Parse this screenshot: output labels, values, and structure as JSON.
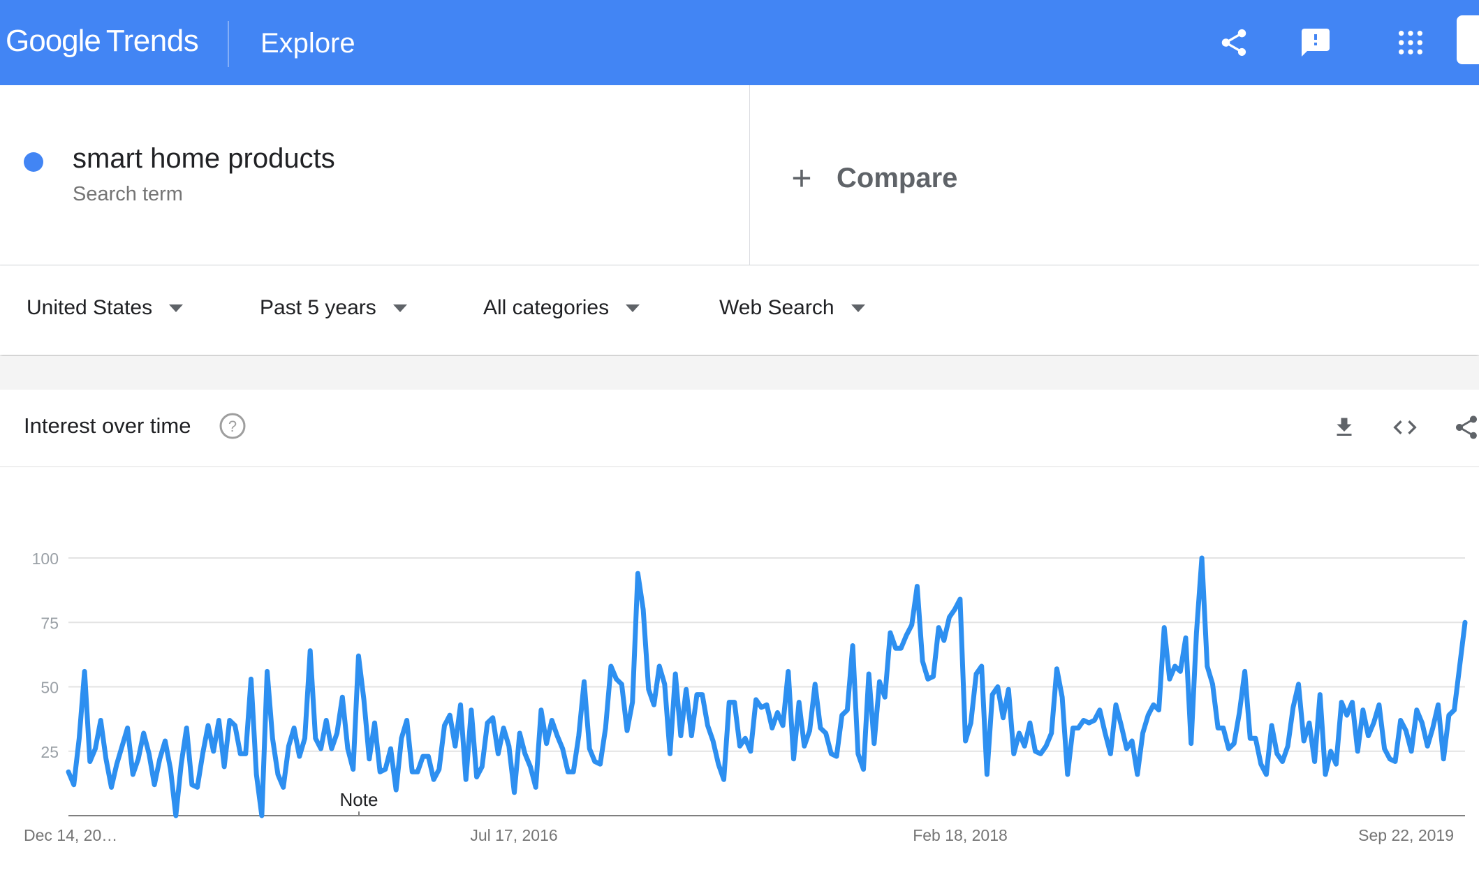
{
  "header": {
    "brand_google": "Google",
    "brand_trends": "Trends",
    "page": "Explore",
    "bg_color": "#4285f4",
    "icons": [
      "share-icon",
      "feedback-icon",
      "apps-grid-icon"
    ]
  },
  "search": {
    "term": "smart home products",
    "term_type": "Search term",
    "term_color": "#4285f4",
    "compare_symbol": "+",
    "compare_label": "Compare"
  },
  "filters": {
    "geo": "United States",
    "time": "Past 5 years",
    "category": "All categories",
    "property": "Web Search"
  },
  "card": {
    "title": "Interest over time",
    "help_symbol": "?",
    "icons": [
      "download-icon",
      "embed-code-icon",
      "share-icon"
    ]
  },
  "chart_data": {
    "type": "line",
    "title": "",
    "xlabel": "",
    "ylabel": "",
    "ylim": [
      0,
      100
    ],
    "y_ticks": [
      "25",
      "50",
      "75",
      "100"
    ],
    "grid": true,
    "line_color": "#2d8ff0",
    "x_tick_labels": [
      "Dec 14, 20…",
      "Jul 17, 2016",
      "Feb 18, 2018",
      "Sep 22, 2019"
    ],
    "annotation": "Note",
    "series": [
      {
        "name": "",
        "values": [
          17,
          12,
          30,
          56,
          21,
          26,
          37,
          22,
          11,
          20,
          27,
          34,
          16,
          22,
          32,
          24,
          12,
          22,
          29,
          18,
          0,
          20,
          34,
          12,
          11,
          24,
          35,
          25,
          37,
          19,
          37,
          35,
          24,
          24,
          53,
          16,
          0,
          56,
          30,
          16,
          11,
          27,
          34,
          23,
          30,
          64,
          30,
          26,
          37,
          26,
          32,
          46,
          26,
          18,
          62,
          45,
          22,
          36,
          17,
          18,
          26,
          10,
          30,
          37,
          17,
          17,
          23,
          23,
          14,
          18,
          35,
          39,
          27,
          43,
          14,
          41,
          15,
          19,
          36,
          38,
          24,
          34,
          27,
          9,
          32,
          24,
          19,
          11,
          41,
          28,
          37,
          31,
          26,
          17,
          17,
          31,
          52,
          26,
          21,
          20,
          34,
          58,
          53,
          51,
          33,
          44,
          94,
          80,
          49,
          43,
          58,
          51,
          24,
          55,
          31,
          49,
          31,
          47,
          47,
          35,
          29,
          20,
          14,
          44,
          44,
          27,
          30,
          25,
          45,
          42,
          43,
          34,
          40,
          35,
          56,
          22,
          44,
          27,
          33,
          51,
          34,
          32,
          24,
          23,
          39,
          41,
          66,
          24,
          18,
          55,
          28,
          52,
          46,
          71,
          65,
          65,
          70,
          74,
          89,
          60,
          53,
          54,
          73,
          68,
          77,
          80,
          84,
          29,
          36,
          55,
          58,
          16,
          47,
          50,
          38,
          49,
          24,
          32,
          27,
          36,
          25,
          24,
          27,
          32,
          57,
          46,
          16,
          34,
          34,
          37,
          36,
          37,
          41,
          32,
          24,
          43,
          35,
          26,
          29,
          16,
          32,
          39,
          43,
          41,
          73,
          53,
          58,
          56,
          69,
          28,
          71,
          100,
          58,
          51,
          34,
          34,
          26,
          28,
          40,
          56,
          30,
          30,
          20,
          16,
          35,
          24,
          21,
          27,
          42,
          51,
          29,
          36,
          21,
          47,
          16,
          25,
          20,
          44,
          39,
          44,
          25,
          41,
          31,
          36,
          43,
          26,
          22,
          21,
          37,
          33,
          25,
          41,
          36,
          27,
          34,
          43,
          22,
          39,
          41,
          58,
          75
        ]
      }
    ]
  }
}
